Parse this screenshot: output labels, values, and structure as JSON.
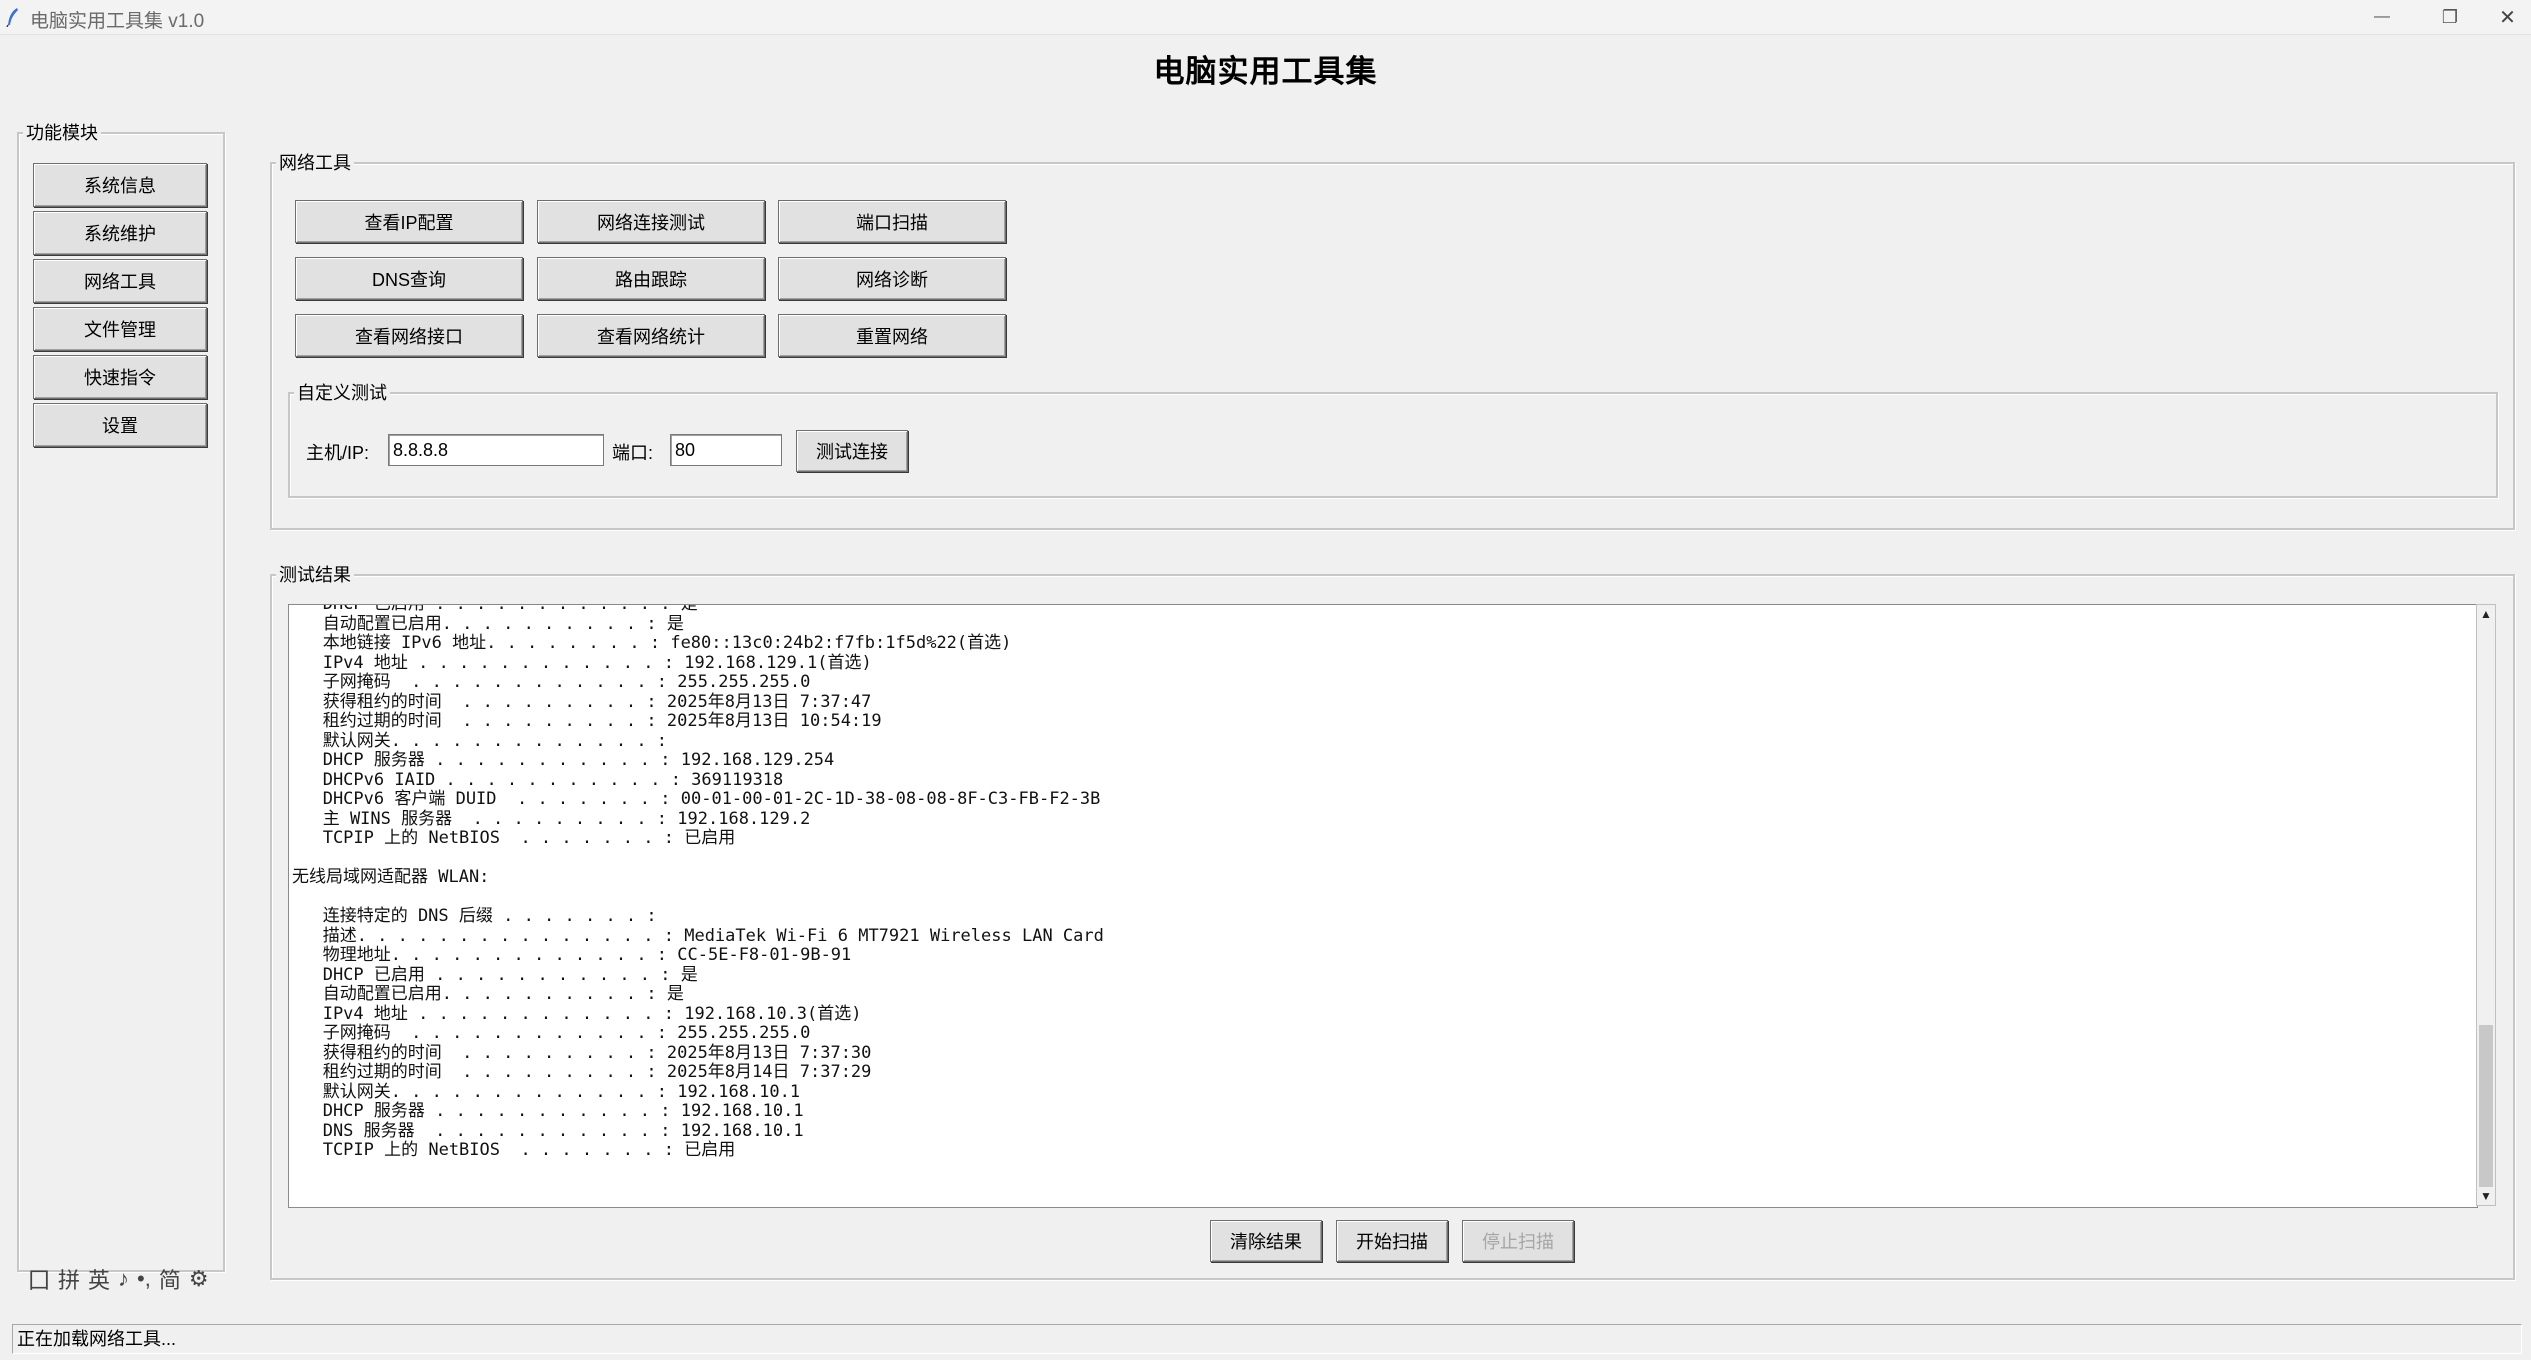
{
  "window": {
    "title": "电脑实用工具集 v1.0",
    "minimize_glyph": "—",
    "restore_glyph": "❐",
    "close_glyph": "✕"
  },
  "app_heading": "电脑实用工具集",
  "sidebar": {
    "label": "功能模块",
    "items": [
      "系统信息",
      "系统维护",
      "网络工具",
      "文件管理",
      "快速指令",
      "设置"
    ]
  },
  "network_tools": {
    "label": "网络工具",
    "buttons": [
      "查看IP配置",
      "网络连接测试",
      "端口扫描",
      "DNS查询",
      "路由跟踪",
      "网络诊断",
      "查看网络接口",
      "查看网络统计",
      "重置网络"
    ]
  },
  "custom_test": {
    "label": "自定义测试",
    "host_label": "主机/IP:",
    "host_value": "8.8.8.8",
    "port_label": "端口:",
    "port_value": "80",
    "test_button": "测试连接"
  },
  "results": {
    "label": "测试结果",
    "output": "   DHCP 已启用 . . . . . . . . . . . : 是\n   自动配置已启用. . . . . . . . . . : 是\n   本地链接 IPv6 地址. . . . . . . . : fe80::13c0:24b2:f7fb:1f5d%22(首选)\n   IPv4 地址 . . . . . . . . . . . . : 192.168.129.1(首选)\n   子网掩码  . . . . . . . . . . . . : 255.255.255.0\n   获得租约的时间  . . . . . . . . . : 2025年8月13日 7:37:47\n   租约过期的时间  . . . . . . . . . : 2025年8月13日 10:54:19\n   默认网关. . . . . . . . . . . . . :\n   DHCP 服务器 . . . . . . . . . . . : 192.168.129.254\n   DHCPv6 IAID . . . . . . . . . . . : 369119318\n   DHCPv6 客户端 DUID  . . . . . . . : 00-01-00-01-2C-1D-38-08-08-8F-C3-FB-F2-3B\n   主 WINS 服务器  . . . . . . . . . : 192.168.129.2\n   TCPIP 上的 NetBIOS  . . . . . . . : 已启用\n\n无线局域网适配器 WLAN:\n\n   连接特定的 DNS 后缀 . . . . . . . :\n   描述. . . . . . . . . . . . . . . : MediaTek Wi-Fi 6 MT7921 Wireless LAN Card\n   物理地址. . . . . . . . . . . . . : CC-5E-F8-01-9B-91\n   DHCP 已启用 . . . . . . . . . . . : 是\n   自动配置已启用. . . . . . . . . . : 是\n   IPv4 地址 . . . . . . . . . . . . : 192.168.10.3(首选)\n   子网掩码  . . . . . . . . . . . . : 255.255.255.0\n   获得租约的时间  . . . . . . . . . : 2025年8月13日 7:37:30\n   租约过期的时间  . . . . . . . . . : 2025年8月14日 7:37:29\n   默认网关. . . . . . . . . . . . . : 192.168.10.1\n   DHCP 服务器 . . . . . . . . . . . : 192.168.10.1\n   DNS 服务器  . . . . . . . . . . . : 192.168.10.1\n   TCPIP 上的 NetBIOS  . . . . . . . : 已启用",
    "clear_button": "清除结果",
    "start_button": "开始扫描",
    "stop_button": "停止扫描"
  },
  "ime_toolbar": [
    "囗",
    "拼",
    "英",
    "♪",
    "•,",
    "简",
    "⚙"
  ],
  "status_text": "正在加载网络工具..."
}
